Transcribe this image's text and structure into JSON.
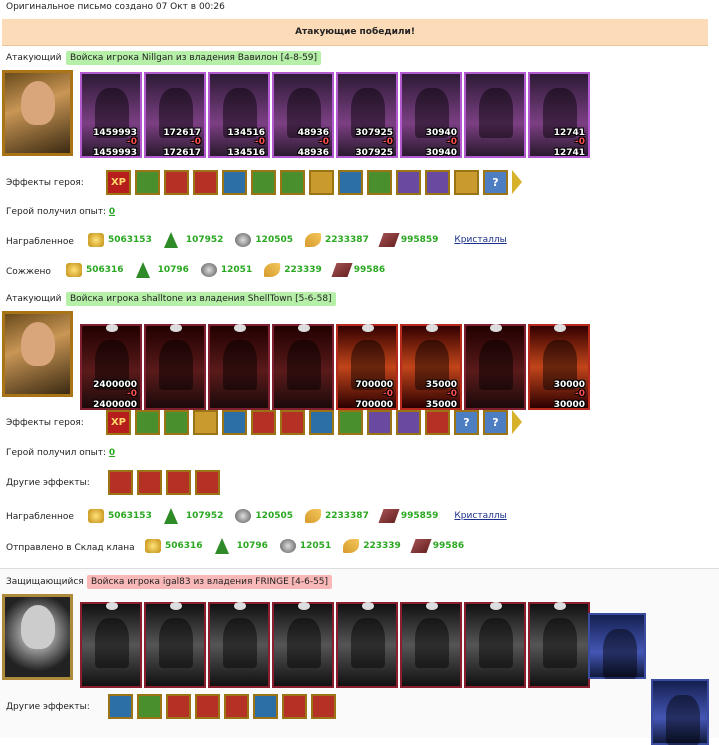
{
  "top_note": "Оригинальное письмо создано 07 Окт в 00:26",
  "banner": "Атакующие победили!",
  "attacker1": {
    "role": "Атакующий",
    "army": "Войска игрока Nillgan из владения Вавилон [4-8-59]",
    "units": [
      {
        "n1": "1459993",
        "z": "-0",
        "n2": "1459993"
      },
      {
        "n1": "172617",
        "z": "-0",
        "n2": "172617"
      },
      {
        "n1": "134516",
        "z": "-0",
        "n2": "134516"
      },
      {
        "n1": "48936",
        "z": "-0",
        "n2": "48936"
      },
      {
        "n1": "307925",
        "z": "-0",
        "n2": "307925"
      },
      {
        "n1": "30940",
        "z": "-0",
        "n2": "30940"
      },
      {
        "n1": "",
        "z": "",
        "n2": ""
      },
      {
        "n1": "12741",
        "z": "-0",
        "n2": "12741"
      }
    ],
    "effects_label": "Эффекты героя:",
    "effects": [
      "XP",
      "",
      "",
      "",
      "",
      "",
      "",
      "",
      "",
      "",
      "",
      "",
      "",
      "",
      "?"
    ],
    "exp_label": "Герой получил опыт:",
    "exp_value": "0",
    "loot_label": "Награбленное",
    "loot": [
      "5063153",
      "107952",
      "120505",
      "2233387",
      "995859"
    ],
    "loot_link": "Кристаллы",
    "burned_label": "Сожжено",
    "burned": [
      "506316",
      "10796",
      "12051",
      "223339",
      "99586"
    ]
  },
  "attacker2": {
    "role": "Атакующий",
    "army": "Войска игрока shalltone из владения ShellTown [5-6-58]",
    "units": [
      {
        "n1": "2400000",
        "z": "-0",
        "n2": "2400000"
      },
      {
        "n1": "",
        "z": "",
        "n2": ""
      },
      {
        "n1": "",
        "z": "",
        "n2": ""
      },
      {
        "n1": "",
        "z": "",
        "n2": ""
      },
      {
        "n1": "700000",
        "z": "-0",
        "n2": "700000"
      },
      {
        "n1": "35000",
        "z": "-0",
        "n2": "35000"
      },
      {
        "n1": "",
        "z": "",
        "n2": ""
      },
      {
        "n1": "30000",
        "z": "-0",
        "n2": "30000"
      }
    ],
    "effects_label": "Эффекты героя:",
    "effects": [
      "XP",
      "",
      "",
      "",
      "",
      "",
      "",
      "",
      "",
      "",
      "",
      "",
      "",
      "",
      "?",
      "?"
    ],
    "exp_label": "Герой получил опыт:",
    "exp_value": "0",
    "other_label": "Другие эффекты:",
    "other_effects": [
      "",
      "",
      "",
      ""
    ],
    "loot_label": "Награбленное",
    "loot": [
      "5063153",
      "107952",
      "120505",
      "2233387",
      "995859"
    ],
    "loot_link": "Кристаллы",
    "sent_label": "Отправлено в Склад клана",
    "sent": [
      "506316",
      "10796",
      "12051",
      "223339",
      "99586"
    ]
  },
  "defender": {
    "role": "Защищающийся",
    "army": "Войска игрока igal83 из владения FRINGE [4-6-55]",
    "other_label": "Другие эффекты:",
    "other_effects": [
      "",
      "",
      "",
      "",
      "",
      "",
      "",
      ""
    ]
  },
  "colors": {
    "banner": "#fcdbb8",
    "army_green": "#b6f0a8",
    "army_red": "#f9b8b8",
    "value_green": "#2aa821"
  }
}
